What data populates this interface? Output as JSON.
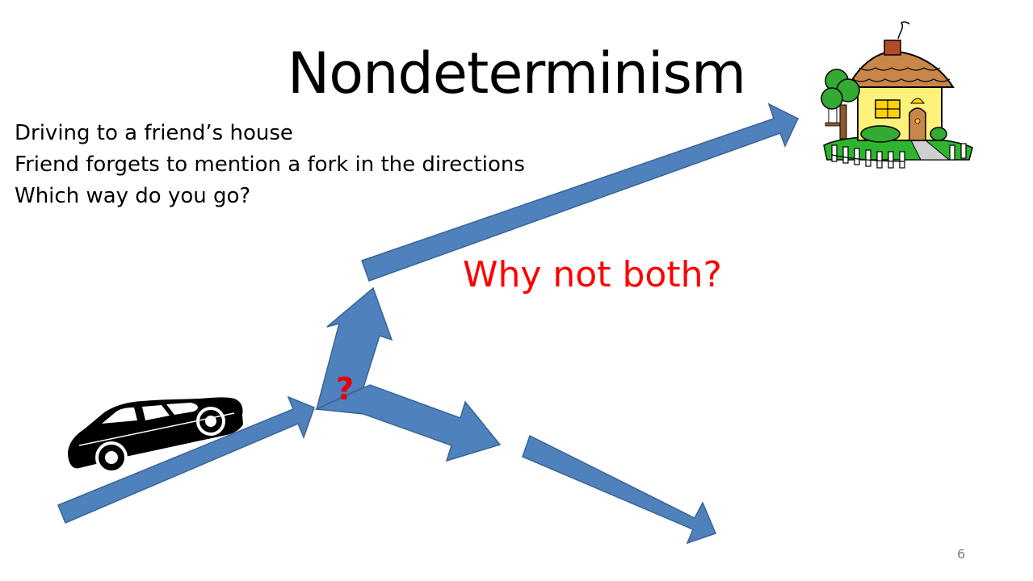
{
  "slide": {
    "title": "Nondeterminism",
    "bullets": [
      "Driving to a friend’s house",
      "Friend forgets to mention a fork in the directions",
      "Which way do you go?"
    ],
    "callout": "Why not both?",
    "fork_mark": "?",
    "page_number": "6"
  },
  "colors": {
    "arrow_fill": "#4f81bd",
    "arrow_stroke": "#3a6496",
    "callout": "#ff0000",
    "fork_mark": "#e60000",
    "page_number": "#7f7f7f"
  },
  "icons": {
    "car": "car-icon",
    "house": "house-icon"
  }
}
